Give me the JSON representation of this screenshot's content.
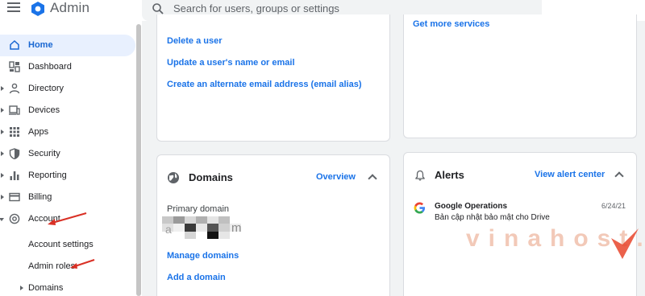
{
  "app": {
    "title": "Admin"
  },
  "search": {
    "placeholder": "Search for users, groups or settings"
  },
  "sidebar": {
    "items": [
      {
        "label": "Home"
      },
      {
        "label": "Dashboard"
      },
      {
        "label": "Directory"
      },
      {
        "label": "Devices"
      },
      {
        "label": "Apps"
      },
      {
        "label": "Security"
      },
      {
        "label": "Reporting"
      },
      {
        "label": "Billing"
      },
      {
        "label": "Account"
      }
    ],
    "sub_items": [
      {
        "label": "Account settings"
      },
      {
        "label": "Admin roles"
      },
      {
        "label": "Domains"
      }
    ]
  },
  "users_card": {
    "links": [
      "Delete a user",
      "Update a user's name or email",
      "Create an alternate email address (email alias)"
    ]
  },
  "services_card": {
    "link": "Get more services"
  },
  "domains_card": {
    "title": "Domains",
    "overview": "Overview",
    "primary_label": "Primary domain",
    "primary_value_fragments": [
      "a",
      "m"
    ],
    "manage": "Manage domains",
    "add": "Add a domain"
  },
  "alerts_card": {
    "title": "Alerts",
    "view_all": "View alert center",
    "alert": {
      "source": "Google Operations",
      "message": "Bản cập nhật bảo mật cho Drive",
      "date": "6/24/21"
    }
  },
  "watermark": {
    "text": "vinahost."
  },
  "colors": {
    "accent": "#1a73e8",
    "active_bg": "#e8f0fe",
    "annotation": "#d93025"
  }
}
